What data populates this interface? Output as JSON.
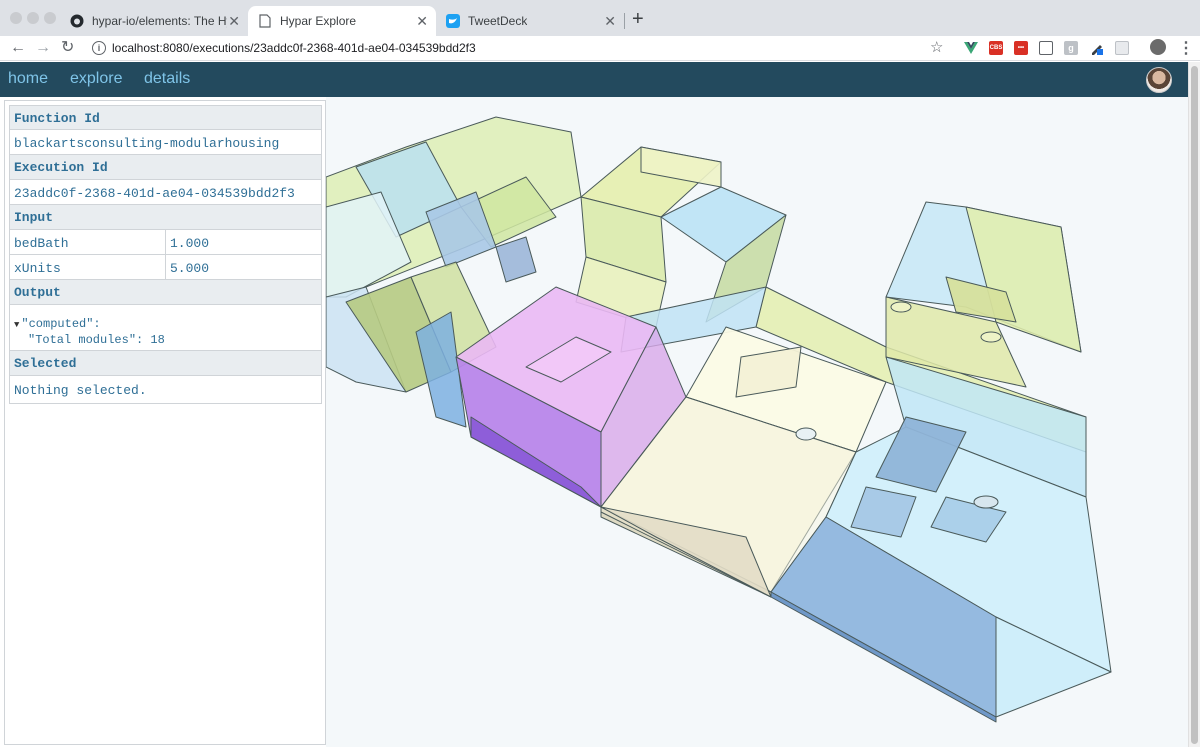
{
  "browser": {
    "tabs": [
      {
        "title": "hypar-io/elements: The Hypar",
        "icon": "github-icon"
      },
      {
        "title": "Hypar Explore",
        "icon": "page-icon"
      },
      {
        "title": "TweetDeck",
        "icon": "tweetdeck-icon"
      }
    ],
    "close_glyph": "✕",
    "new_tab_glyph": "+",
    "url": "localhost:8080/executions/23addc0f-2368-401d-ae04-034539bdd2f3",
    "info_glyph": "i",
    "star_glyph": "☆",
    "back_glyph": "←",
    "forward_glyph": "→",
    "reload_glyph": "↻",
    "menu_glyph": "⋮",
    "extensions": [
      {
        "name": "vue-devtools-icon",
        "label": "V",
        "color": "#3aa776"
      },
      {
        "name": "cbs-extension-icon",
        "label": "CBS",
        "color": "#d93025"
      },
      {
        "name": "red-extension-icon",
        "label": "•••",
        "color": "#d93025"
      },
      {
        "name": "screen-capture-icon",
        "label": "",
        "color": "#5f6368"
      },
      {
        "name": "g-extension-icon",
        "label": "g",
        "color": "#9aa0a6"
      },
      {
        "name": "pen-extension-icon",
        "label": "",
        "color": "#1a73e8"
      },
      {
        "name": "gray-extension-icon",
        "label": "",
        "color": "#bdc1c6"
      }
    ]
  },
  "nav": {
    "home": "home",
    "explore": "explore",
    "details": "details"
  },
  "panel": {
    "function_id_label": "Function Id",
    "function_id_value": "blackartsconsulting-modularhousing",
    "execution_id_label": "Execution Id",
    "execution_id_value": "23addc0f-2368-401d-ae04-034539bdd2f3",
    "input_label": "Input",
    "inputs": [
      {
        "key": "bedBath",
        "value": "1.000"
      },
      {
        "key": "xUnits",
        "value": "5.000"
      }
    ],
    "output_label": "Output",
    "output_caret": "▼",
    "output_key": "\"computed\":",
    "output_line": "\"Total modules\": 18",
    "selected_label": "Selected",
    "selected_value": "Nothing selected."
  },
  "colors": {
    "nav_bg": "#234a5e",
    "nav_link": "#7fc4e8",
    "label_text": "#2f6f96",
    "module_blue": "#a9dcf2",
    "module_yellow": "#e4eea8",
    "module_purple": "#c78ff0",
    "module_cream": "#f6f4dc"
  }
}
